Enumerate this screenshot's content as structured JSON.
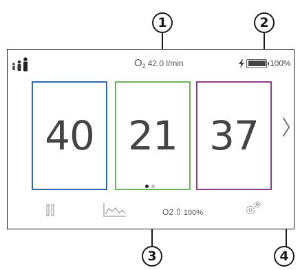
{
  "callouts": [
    "1",
    "2",
    "3",
    "4"
  ],
  "status": {
    "o2_symbol": "O",
    "o2_subscript": "2",
    "flow_rate": "42.0 l/min",
    "battery_percent": "100%",
    "battery_level": 1.0
  },
  "tiles": [
    {
      "value": "40",
      "color": "#2f6aa8"
    },
    {
      "value": "21",
      "color": "#6bb35f"
    },
    {
      "value": "37",
      "color": "#8e3c8c"
    }
  ],
  "pager": {
    "pages": 2,
    "active_page": 1
  },
  "next_chevron": "〉",
  "bottom": {
    "pause_icon": "pause-icon",
    "trend_icon": "trend-chart-icon",
    "o2_label": "O2",
    "o2_arrow": "⇧",
    "o2_percent": "100%",
    "settings_icon": "settings-gears-icon"
  },
  "icons": {
    "patient": "adult-child-icon",
    "charging": "charging-bolt-icon"
  }
}
